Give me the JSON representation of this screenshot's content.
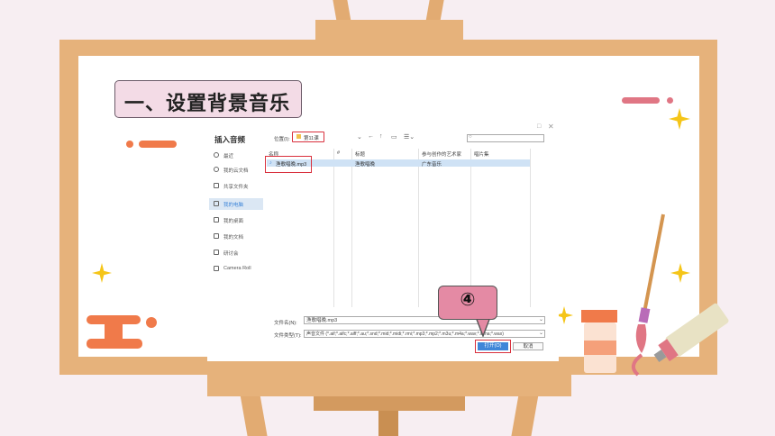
{
  "slide": {
    "title": "一、设置背景音乐",
    "callout_number": "④"
  },
  "dialog": {
    "window_title": "插入音频",
    "location_label": "位置(I):",
    "location_value": "第11课",
    "search_placeholder": "",
    "nav_items": [
      {
        "label": "最近",
        "icon": "clock-icon"
      },
      {
        "label": "我的云文档",
        "icon": "cloud-icon"
      },
      {
        "label": "共享文件夹",
        "icon": "share-icon"
      },
      {
        "label": "我的电脑",
        "icon": "computer-icon",
        "selected": true
      },
      {
        "label": "我的桌面",
        "icon": "desktop-icon"
      },
      {
        "label": "我的文档",
        "icon": "folder-icon"
      },
      {
        "label": "研讨会",
        "icon": "folder-icon"
      },
      {
        "label": "Camera Roll",
        "icon": "folder-icon"
      }
    ],
    "columns": [
      "名称",
      "#",
      "标题",
      "参与创作的艺术家",
      "唱片集"
    ],
    "files": [
      {
        "name": "渔歌唱晚.mp3",
        "number": "",
        "title": "渔歌唱晚",
        "artist": "广东音乐",
        "album": ""
      }
    ],
    "filename_label": "文件名(N):",
    "filename_value": "渔歌唱晚.mp3",
    "filetype_label": "文件类型(T):",
    "filetype_value": "声音文件 (*.aif;*.aifc;*.aiff;*.au;*.snd;*.mid;*.midi;*.rmi;*.mp3;*.mp2;*.m3u;*.m4a;*.wav;*.wma;*.wax)",
    "open_label": "打开(O)",
    "cancel_label": "取消"
  },
  "colors": {
    "accent_red": "#d9303d",
    "callout_pink": "#e48aa4",
    "easel": "#e6b27b",
    "button_blue": "#3f86d8"
  }
}
